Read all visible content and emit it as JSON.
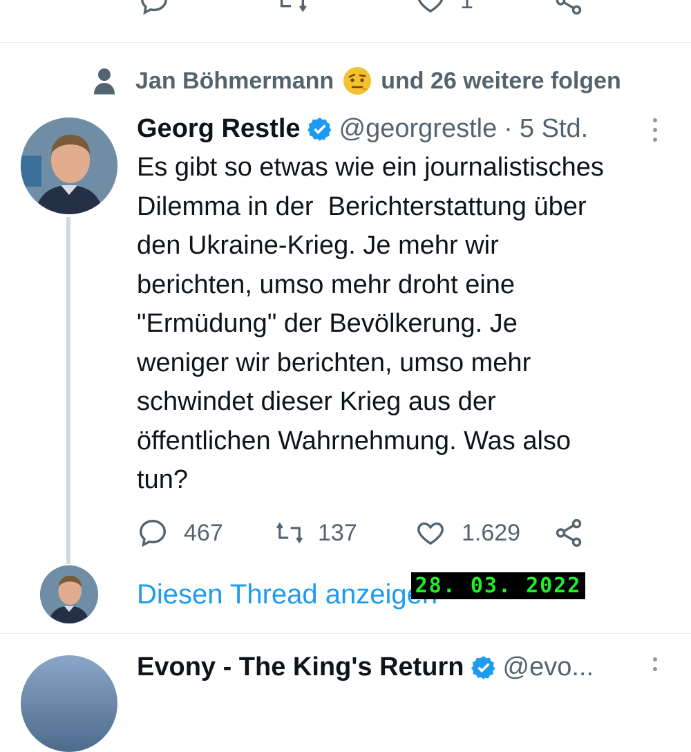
{
  "colors": {
    "accent": "#1d9bf0",
    "muted": "#536471",
    "text": "#0f1419",
    "divider": "#e6ecf0"
  },
  "previous_tweet": {
    "like_count": "1"
  },
  "social_context": {
    "icon": "person-icon",
    "user_name": "Jan Böhmermann",
    "suffix": "und 26 weitere folgen"
  },
  "tweet": {
    "author_name": "Georg Restle",
    "verified_icon": "verified-badge-icon",
    "handle": "@georgrestle",
    "separator": "·",
    "time": "5 Std.",
    "text": "Es gibt so etwas wie ein journalistisches\nDilemma in der  Berichterstattung über\nden Ukraine-Krieg. Je mehr wir\nberichten, umso mehr droht eine\n\"Ermüdung\" der Bevölkerung. Je\nweniger wir berichten, umso mehr\nschwindet dieser Krieg aus der\nöffentlichen Wahrnehmung. Was also\ntun?",
    "reply_count": "467",
    "retweet_count": "137",
    "like_count": "1.629",
    "show_thread": "Diesen Thread anzeigen"
  },
  "date_stamp": "28. 03. 2022",
  "next_tweet": {
    "author_name": "Evony - The King's Return",
    "handle": "@evo..."
  }
}
